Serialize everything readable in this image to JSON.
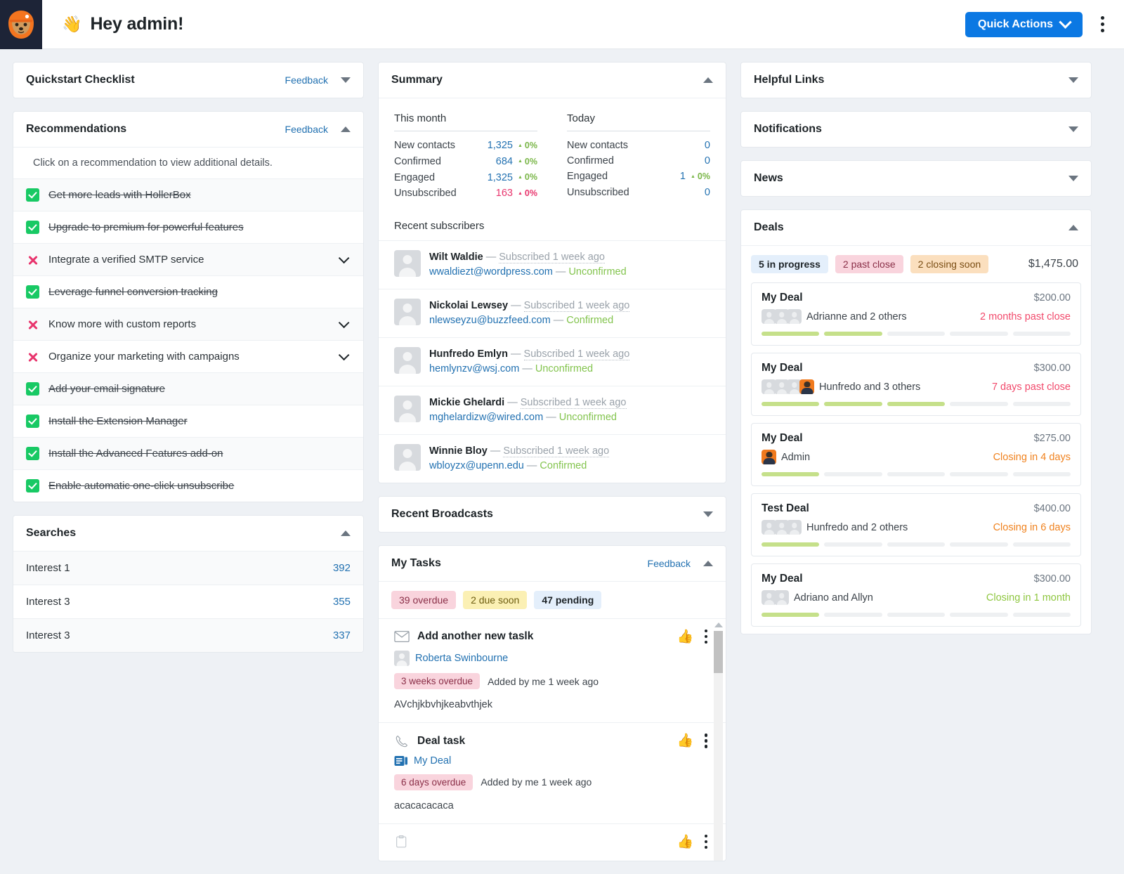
{
  "topbar": {
    "greeting": "Hey admin!",
    "wave_emoji": "👋",
    "quick_actions_label": "Quick Actions"
  },
  "left": {
    "quickstart": {
      "title": "Quickstart Checklist",
      "feedback": "Feedback"
    },
    "recommendations": {
      "title": "Recommendations",
      "feedback": "Feedback",
      "note": "Click on a recommendation to view additional details.",
      "items": [
        {
          "label": "Get more leads with HollerBox",
          "done": true
        },
        {
          "label": "Upgrade to premium for powerful features",
          "done": true
        },
        {
          "label": "Integrate a verified SMTP service",
          "done": false
        },
        {
          "label": "Leverage funnel conversion tracking",
          "done": true
        },
        {
          "label": "Know more with custom reports",
          "done": false
        },
        {
          "label": "Organize your marketing with campaigns",
          "done": false
        },
        {
          "label": "Add your email signature",
          "done": true
        },
        {
          "label": "Install the Extension Manager",
          "done": true
        },
        {
          "label": "Install the Advanced Features add-on",
          "done": true
        },
        {
          "label": "Enable automatic one-click unsubscribe",
          "done": true
        }
      ]
    },
    "searches": {
      "title": "Searches",
      "rows": [
        {
          "name": "Interest 1",
          "count": "392"
        },
        {
          "name": "Interest 3",
          "count": "355"
        },
        {
          "name": "Interest 3",
          "count": "337"
        }
      ]
    }
  },
  "middle": {
    "summary": {
      "title": "Summary",
      "this_month": {
        "heading": "This month",
        "rows": [
          {
            "k": "New contacts",
            "v": "1,325",
            "delta": "0%",
            "dir": "up"
          },
          {
            "k": "Confirmed",
            "v": "684",
            "delta": "0%",
            "dir": "up"
          },
          {
            "k": "Engaged",
            "v": "1,325",
            "delta": "0%",
            "dir": "up"
          },
          {
            "k": "Unsubscribed",
            "v": "163",
            "delta": "0%",
            "dir": "down"
          }
        ]
      },
      "today": {
        "heading": "Today",
        "rows": [
          {
            "k": "New contacts",
            "v": "0",
            "delta": "",
            "dir": ""
          },
          {
            "k": "Confirmed",
            "v": "0",
            "delta": "",
            "dir": ""
          },
          {
            "k": "Engaged",
            "v": "1",
            "delta": "0%",
            "dir": "up"
          },
          {
            "k": "Unsubscribed",
            "v": "0",
            "delta": "",
            "dir": ""
          }
        ]
      },
      "recent_subscribers_heading": "Recent subscribers",
      "subscribers": [
        {
          "name": "Wilt Waldie",
          "sep": "—",
          "when": "Subscribed 1 week ago",
          "email": "wwaldiezt@wordpress.com",
          "status": "Unconfirmed"
        },
        {
          "name": "Nickolai Lewsey",
          "sep": "—",
          "when": "Subscribed 1 week ago",
          "email": "nlewseyzu@buzzfeed.com",
          "status": "Confirmed"
        },
        {
          "name": "Hunfredo Emlyn",
          "sep": "—",
          "when": "Subscribed 1 week ago",
          "email": "hemlynzv@wsj.com",
          "status": "Unconfirmed"
        },
        {
          "name": "Mickie Ghelardi",
          "sep": "—",
          "when": "Subscribed 1 week ago",
          "email": "mghelardizw@wired.com",
          "status": "Unconfirmed"
        },
        {
          "name": "Winnie Bloy",
          "sep": "—",
          "when": "Subscribed 1 week ago",
          "email": "wbloyzx@upenn.edu",
          "status": "Confirmed"
        }
      ]
    },
    "recent_broadcasts": {
      "title": "Recent Broadcasts"
    },
    "my_tasks": {
      "title": "My Tasks",
      "feedback": "Feedback",
      "chips": [
        {
          "label": "39 overdue",
          "tone": "red"
        },
        {
          "label": "2 due soon",
          "tone": "yel"
        },
        {
          "label": "47 pending",
          "tone": "blue"
        }
      ],
      "tasks": [
        {
          "icon": "envelope-icon",
          "title": "Add another new taslk",
          "person": "Roberta Swinbourne",
          "badge": "3 weeks overdue",
          "added": "Added by me 1 week ago",
          "desc": "AVchjkbvhjkeabvthjek"
        },
        {
          "icon": "phone-icon",
          "title": "Deal task",
          "deal": "My Deal",
          "badge": "6 days overdue",
          "added": "Added by me 1 week ago",
          "desc": "acacacacaca"
        },
        {
          "icon": "clipboard-icon",
          "title": "",
          "badge": "",
          "added": "",
          "desc": ""
        }
      ]
    }
  },
  "right": {
    "helpful_links": {
      "title": "Helpful Links"
    },
    "notifications": {
      "title": "Notifications"
    },
    "news": {
      "title": "News"
    },
    "deals": {
      "title": "Deals",
      "chips": [
        {
          "label": "5 in progress",
          "tone": "blue"
        },
        {
          "label": "2 past close",
          "tone": "red"
        },
        {
          "label": "2 closing soon",
          "tone": "orange"
        }
      ],
      "total": "$1,475.00",
      "cards": [
        {
          "name": "My Deal",
          "amount": "$200.00",
          "people": "Adrianne and 2 others",
          "faces": 3,
          "admin_face": false,
          "status": "2 months past close",
          "tone": "st-red",
          "progress": 2,
          "segments": 5
        },
        {
          "name": "My Deal",
          "amount": "$300.00",
          "people": "Hunfredo and 3 others",
          "faces": 3,
          "admin_face": true,
          "status": "7 days past close",
          "tone": "st-red",
          "progress": 3,
          "segments": 5
        },
        {
          "name": "My Deal",
          "amount": "$275.00",
          "people": "Admin",
          "faces": 0,
          "admin_face": true,
          "status": "Closing in 4 days",
          "tone": "st-orange",
          "progress": 1,
          "segments": 5
        },
        {
          "name": "Test Deal",
          "amount": "$400.00",
          "people": "Hunfredo and 2 others",
          "faces": 3,
          "admin_face": false,
          "status": "Closing in 6 days",
          "tone": "st-orange",
          "progress": 1,
          "segments": 5
        },
        {
          "name": "My Deal",
          "amount": "$300.00",
          "people": "Adriano and Allyn",
          "faces": 2,
          "admin_face": false,
          "status": "Closing in 1 month",
          "tone": "st-green",
          "progress": 1,
          "segments": 5
        }
      ]
    }
  },
  "colors": {
    "accent": "#0b78e3",
    "link": "#2271b1",
    "green": "#18c964",
    "red": "#e8356d",
    "orange": "#f0821e"
  }
}
